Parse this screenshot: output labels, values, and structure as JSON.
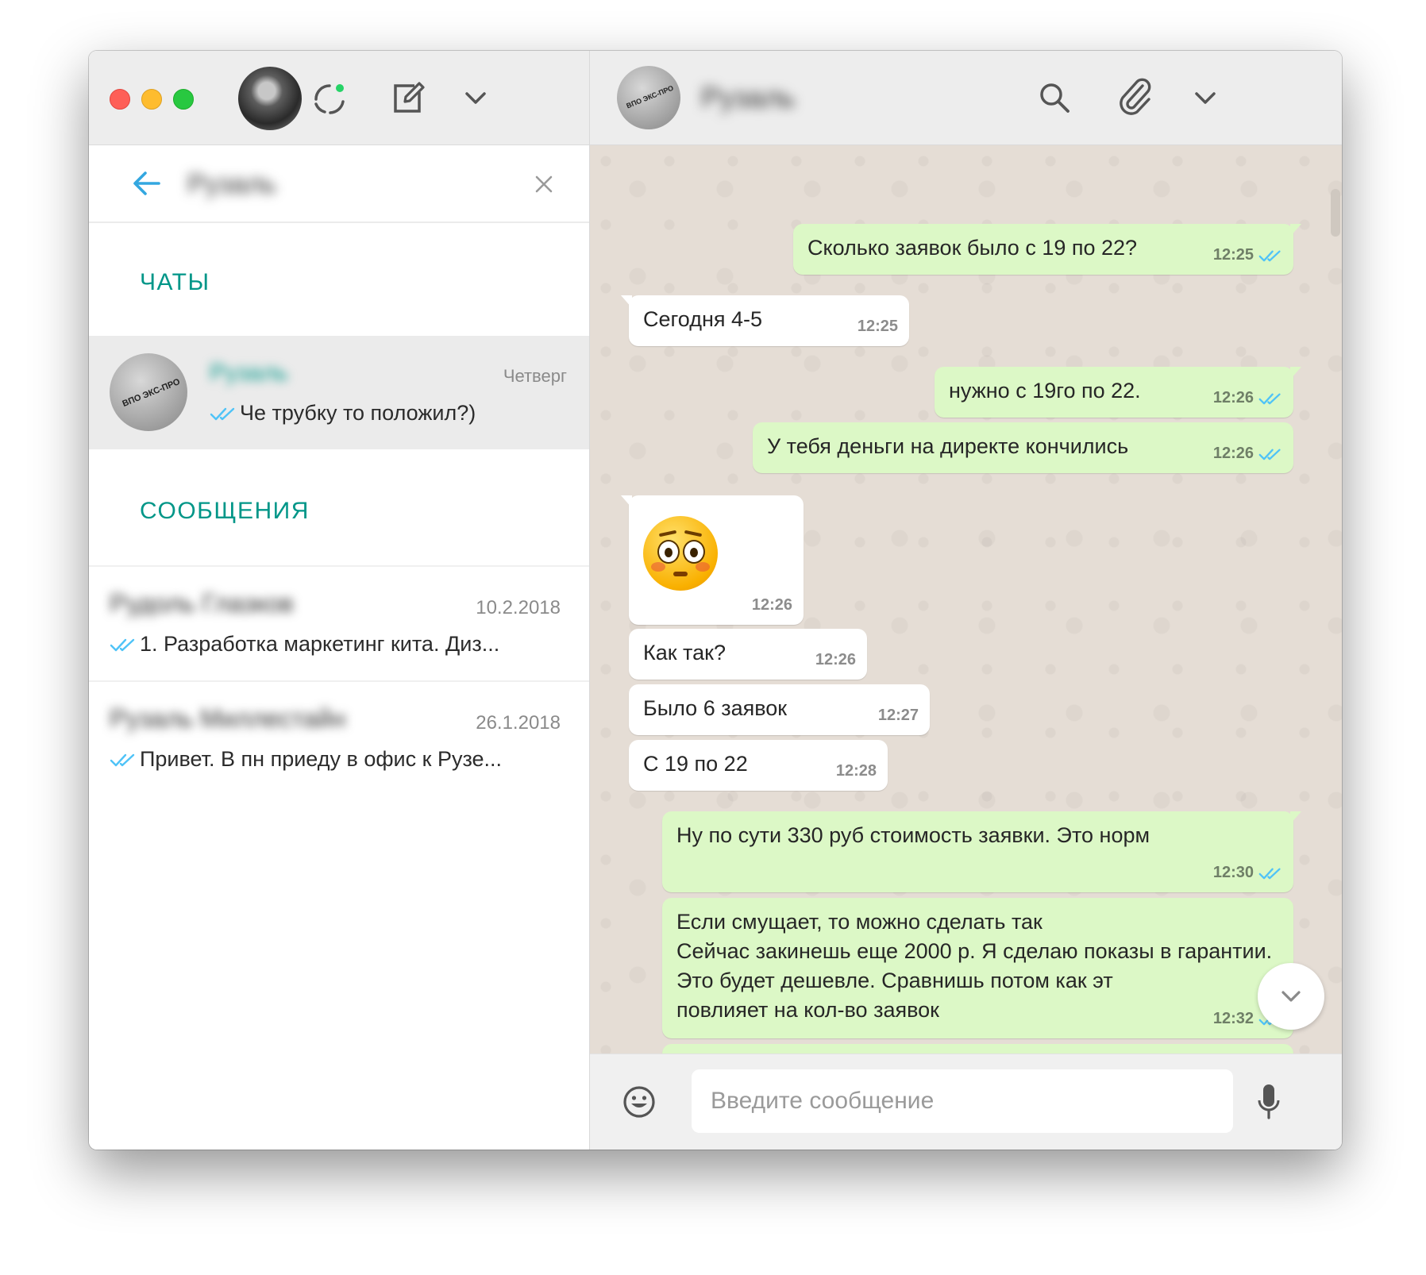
{
  "left": {
    "search_value": "Рузаль",
    "sections": {
      "chats": "ЧАТЫ",
      "messages": "СООБЩЕНИЯ"
    },
    "chat": {
      "name": "Рузаль",
      "date": "Четверг",
      "preview": "Че трубку то положил?)",
      "logo_text": "ВПО ЭКС-ПРО"
    },
    "messages": [
      {
        "name": "Рудоль Глазков",
        "date": "10.2.2018",
        "preview": "1. Разработка маркетинг кита. Диз..."
      },
      {
        "name": "Рузаль Миллестайн",
        "date": "26.1.2018",
        "preview": "Привет. В пн приеду в офис к Рузе..."
      }
    ]
  },
  "header": {
    "contact_name": "Рузаль",
    "icons": [
      "search-icon",
      "paperclip-icon",
      "chevron-down-icon"
    ]
  },
  "left_header_icons": [
    "status-icon",
    "new-chat-icon",
    "chevron-down-icon"
  ],
  "conversation": [
    {
      "dir": "out",
      "text": "Сколько заявок было с 19 по 22?",
      "time": "12:25"
    },
    {
      "dir": "in",
      "text": "Сегодня 4-5",
      "time": "12:25"
    },
    {
      "dir": "out",
      "text": "нужно с 19го по 22.",
      "time": "12:26"
    },
    {
      "dir": "out",
      "text": "У тебя деньги на директе кончились",
      "time": "12:26"
    },
    {
      "dir": "in",
      "text": "",
      "emoji": "flushed-face",
      "time": "12:26"
    },
    {
      "dir": "in",
      "text": "Как так?",
      "time": "12:26"
    },
    {
      "dir": "in",
      "text": "Было 6 заявок",
      "time": "12:27"
    },
    {
      "dir": "in",
      "text": "С 19 по 22",
      "time": "12:28"
    },
    {
      "dir": "out",
      "text": "Ну по сути 330 руб стоимость заявки. Это норм",
      "time": "12:30"
    },
    {
      "dir": "out",
      "text": "Если смущает, то можно сделать так\nСейчас закинешь еще 2000 р. Я сделаю показы в гарантии. Это будет дешевле. Сравнишь потом как эт\nповлияет на кол-во заявок",
      "time": "12:32"
    }
  ],
  "composer": {
    "placeholder": "Введите сообщение"
  },
  "colors": {
    "accent": "#009688",
    "outgoing": "#dcf8c6",
    "incoming": "#ffffff",
    "read_ticks": "#4fc3f7",
    "wallpaper": "#e5ddd5"
  }
}
